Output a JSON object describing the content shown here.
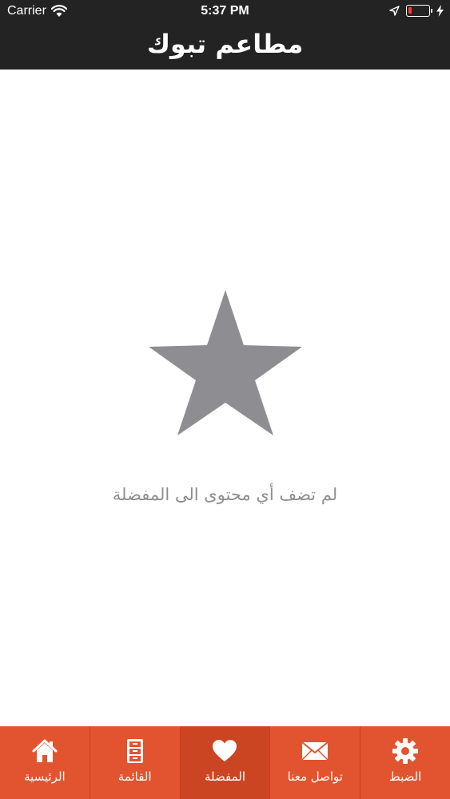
{
  "status_bar": {
    "carrier": "Carrier",
    "time": "5:37 PM",
    "battery_color": "#ff3b30"
  },
  "header": {
    "title": "مطاعم تبوك"
  },
  "empty_state": {
    "icon": "star-icon",
    "message": "لم تضف أي محتوى الى المفضلة"
  },
  "tab_bar": {
    "background": "#e2542f",
    "tabs": [
      {
        "label": "الرئيسية",
        "icon": "home-icon"
      },
      {
        "label": "القائمة",
        "icon": "cabinet-icon"
      },
      {
        "label": "المفضلة",
        "icon": "heart-icon",
        "selected": true
      },
      {
        "label": "تواصل معنا",
        "icon": "envelope-icon"
      },
      {
        "label": "الضبط",
        "icon": "gear-icon"
      }
    ]
  }
}
